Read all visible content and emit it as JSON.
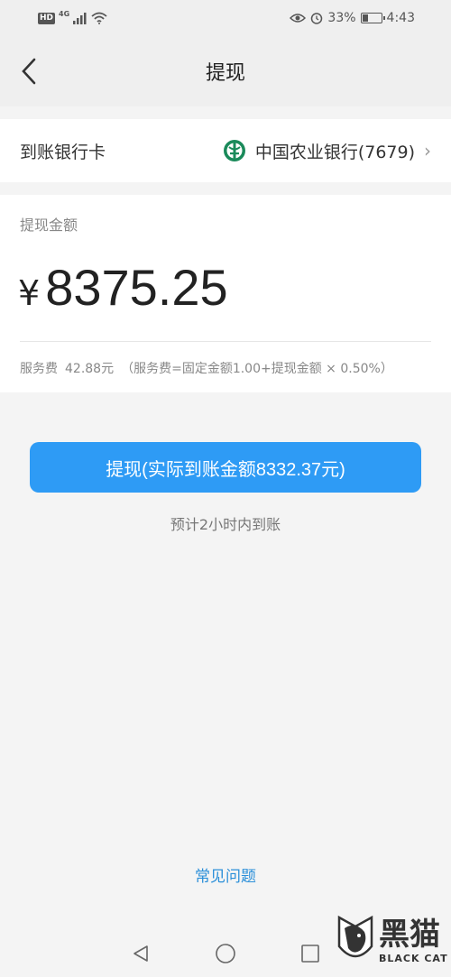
{
  "status_bar": {
    "hd": "HD",
    "network": "4G",
    "battery": "33%",
    "battery_level": 0.33,
    "time": "4:43"
  },
  "header": {
    "title": "提现"
  },
  "bank": {
    "label": "到账银行卡",
    "bank_name": "中国农业银行(7679)",
    "logo_color": "#1a8a5a"
  },
  "amount": {
    "label": "提现金额",
    "currency": "¥",
    "value": "8375.25",
    "fee_label": "服务费",
    "fee_value": "42.88元",
    "fee_formula": "（服务费=固定金额1.00+提现金额 × 0.50%）"
  },
  "action": {
    "button_label": "提现(实际到账金额8332.37元)",
    "eta": "预计2小时内到账",
    "accent": "#2e9bf5"
  },
  "faq": {
    "label": "常见问题"
  },
  "watermark": {
    "cn": "黑猫",
    "en": "BLACK CAT"
  }
}
